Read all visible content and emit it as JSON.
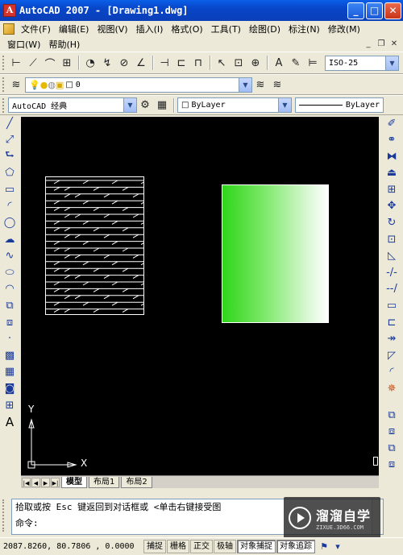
{
  "window": {
    "title": "AutoCAD 2007 - [Drawing1.dwg]",
    "app_icon_letter": "A"
  },
  "menus": {
    "row1": [
      "文件(F)",
      "编辑(E)",
      "视图(V)",
      "插入(I)",
      "格式(O)",
      "工具(T)",
      "绘图(D)",
      "标注(N)",
      "修改(M)"
    ],
    "row2": [
      "窗口(W)",
      "帮助(H)"
    ]
  },
  "dimension_toolbar": {
    "dimstyle_value": "ISO-25"
  },
  "layer_toolbar": {
    "layer_value": "0"
  },
  "workspace_toolbar": {
    "workspace_value": "AutoCAD 经典",
    "color_value": "ByLayer",
    "linetype_value": "ByLayer"
  },
  "canvas": {
    "background": "#000000",
    "hatch_color": "#ffffff",
    "gradient_start": "#2fd61a",
    "gradient_end": "#ffffff",
    "ucs_x_label": "X",
    "ucs_y_label": "Y"
  },
  "layout_tabs": [
    "模型",
    "布局1",
    "布局2"
  ],
  "command": {
    "history_line": "拾取或按 Esc 键返回到对话框或 <单击右键接受图",
    "prompt": "命令:"
  },
  "watermark": {
    "main": "溜溜自学",
    "sub": "ZIXUE.3D66.COM"
  },
  "status": {
    "coordinates": "2087.8260, 80.7806 , 0.0000",
    "buttons": [
      "捕捉",
      "栅格",
      "正交",
      "极轴",
      "对象捕捉",
      "对象追踪"
    ]
  }
}
